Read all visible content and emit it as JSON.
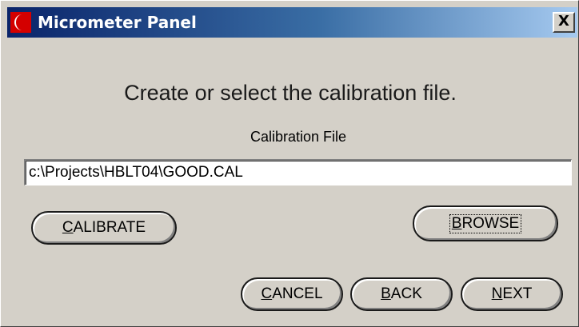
{
  "window": {
    "title": "Micrometer Panel",
    "close_label": "X",
    "title_gradient": [
      "#0a246a",
      "#a6caf0"
    ],
    "face_color": "#d4d0c8"
  },
  "content": {
    "heading": "Create or select the calibration file.",
    "field_label": "Calibration File",
    "file_value": "c:\\Projects\\HBLT04\\GOOD.CAL"
  },
  "buttons": {
    "calibrate": {
      "accel": "C",
      "rest": "ALIBRATE"
    },
    "browse": {
      "accel": "B",
      "rest": "ROWSE"
    },
    "cancel": {
      "accel": "C",
      "rest": "ANCEL"
    },
    "back": {
      "accel": "B",
      "rest": "ACK"
    },
    "next": {
      "accel": "N",
      "rest": "EXT"
    }
  },
  "icons": {
    "app": "crescent-logo-icon",
    "close": "close-icon"
  }
}
